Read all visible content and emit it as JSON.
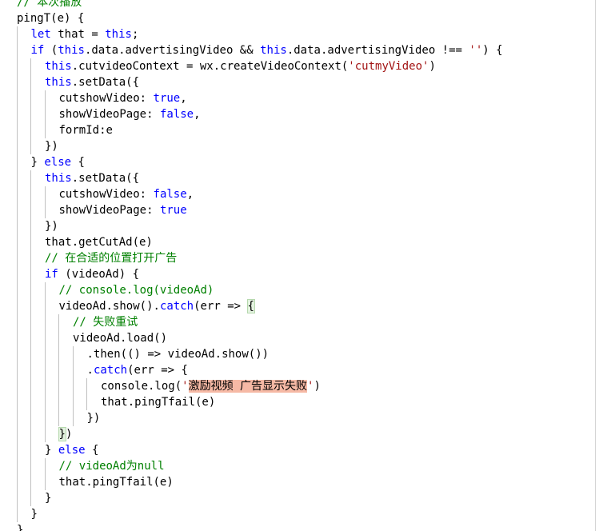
{
  "editor": {
    "colors": {
      "keyword": "#0000ff",
      "string": "#a31515",
      "comment": "#008000",
      "text": "#000000",
      "highlight": "#f6b9a5"
    },
    "lines": [
      {
        "indent": 0,
        "guides": 0,
        "tokens": [
          {
            "c": "cm",
            "v": "// 本次播放"
          }
        ]
      },
      {
        "indent": 0,
        "guides": 0,
        "tokens": [
          {
            "c": "",
            "v": "pingT(e) {"
          }
        ]
      },
      {
        "indent": 1,
        "guides": 1,
        "tokens": [
          {
            "c": "kw",
            "v": "let"
          },
          {
            "c": "",
            "v": " that = "
          },
          {
            "c": "kw",
            "v": "this"
          },
          {
            "c": "",
            "v": ";"
          }
        ]
      },
      {
        "indent": 1,
        "guides": 1,
        "tokens": [
          {
            "c": "kw",
            "v": "if"
          },
          {
            "c": "",
            "v": " ("
          },
          {
            "c": "kw",
            "v": "this"
          },
          {
            "c": "",
            "v": ".data.advertisingVideo && "
          },
          {
            "c": "kw",
            "v": "this"
          },
          {
            "c": "",
            "v": ".data.advertisingVideo !== "
          },
          {
            "c": "str",
            "v": "''"
          },
          {
            "c": "",
            "v": ") {"
          }
        ]
      },
      {
        "indent": 2,
        "guides": 2,
        "tokens": [
          {
            "c": "kw",
            "v": "this"
          },
          {
            "c": "",
            "v": ".cutvideoContext = wx.createVideoContext("
          },
          {
            "c": "str",
            "v": "'cutmyVideo'"
          },
          {
            "c": "",
            "v": ")"
          }
        ]
      },
      {
        "indent": 2,
        "guides": 2,
        "tokens": [
          {
            "c": "kw",
            "v": "this"
          },
          {
            "c": "",
            "v": ".setData({"
          }
        ]
      },
      {
        "indent": 3,
        "guides": 3,
        "tokens": [
          {
            "c": "",
            "v": "cutshowVideo: "
          },
          {
            "c": "kw",
            "v": "true"
          },
          {
            "c": "",
            "v": ","
          }
        ]
      },
      {
        "indent": 3,
        "guides": 3,
        "tokens": [
          {
            "c": "",
            "v": "showVideoPage: "
          },
          {
            "c": "kw",
            "v": "false"
          },
          {
            "c": "",
            "v": ","
          }
        ]
      },
      {
        "indent": 3,
        "guides": 3,
        "tokens": [
          {
            "c": "",
            "v": "formId:e"
          }
        ]
      },
      {
        "indent": 2,
        "guides": 2,
        "tokens": [
          {
            "c": "",
            "v": "})"
          }
        ]
      },
      {
        "indent": 1,
        "guides": 1,
        "tokens": [
          {
            "c": "",
            "v": "} "
          },
          {
            "c": "kw",
            "v": "else"
          },
          {
            "c": "",
            "v": " {"
          }
        ]
      },
      {
        "indent": 2,
        "guides": 2,
        "tokens": [
          {
            "c": "kw",
            "v": "this"
          },
          {
            "c": "",
            "v": ".setData({"
          }
        ]
      },
      {
        "indent": 3,
        "guides": 3,
        "tokens": [
          {
            "c": "",
            "v": "cutshowVideo: "
          },
          {
            "c": "kw",
            "v": "false"
          },
          {
            "c": "",
            "v": ","
          }
        ]
      },
      {
        "indent": 3,
        "guides": 3,
        "tokens": [
          {
            "c": "",
            "v": "showVideoPage: "
          },
          {
            "c": "kw",
            "v": "true"
          }
        ]
      },
      {
        "indent": 2,
        "guides": 2,
        "tokens": [
          {
            "c": "",
            "v": "})"
          }
        ]
      },
      {
        "indent": 2,
        "guides": 2,
        "tokens": [
          {
            "c": "",
            "v": "that.getCutAd(e)"
          }
        ]
      },
      {
        "indent": 2,
        "guides": 2,
        "tokens": [
          {
            "c": "cm",
            "v": "// 在合适的位置打开广告"
          }
        ]
      },
      {
        "indent": 2,
        "guides": 2,
        "tokens": [
          {
            "c": "kw",
            "v": "if"
          },
          {
            "c": "",
            "v": " (videoAd) {"
          }
        ]
      },
      {
        "indent": 3,
        "guides": 3,
        "tokens": [
          {
            "c": "cm",
            "v": "// console.log(videoAd)"
          }
        ]
      },
      {
        "indent": 3,
        "guides": 3,
        "tokens": [
          {
            "c": "",
            "v": "videoAd.show()."
          },
          {
            "c": "kw",
            "v": "catch"
          },
          {
            "c": "",
            "v": "(err => "
          },
          {
            "c": "br",
            "v": "{"
          }
        ]
      },
      {
        "indent": 4,
        "guides": 4,
        "tokens": [
          {
            "c": "cm",
            "v": "// 失败重试"
          }
        ]
      },
      {
        "indent": 4,
        "guides": 4,
        "tokens": [
          {
            "c": "",
            "v": "videoAd.load()"
          }
        ]
      },
      {
        "indent": 5,
        "guides": 5,
        "tokens": [
          {
            "c": "",
            "v": ".then(() => videoAd.show())"
          }
        ]
      },
      {
        "indent": 5,
        "guides": 5,
        "tokens": [
          {
            "c": "",
            "v": "."
          },
          {
            "c": "kw",
            "v": "catch"
          },
          {
            "c": "",
            "v": "(err => {"
          }
        ]
      },
      {
        "indent": 6,
        "guides": 6,
        "tokens": [
          {
            "c": "",
            "v": "console.log("
          },
          {
            "c": "str",
            "v": "'"
          },
          {
            "c": "hl",
            "v": "激励视频 广告显示失败"
          },
          {
            "c": "str",
            "v": "'"
          },
          {
            "c": "",
            "v": ")"
          }
        ]
      },
      {
        "indent": 6,
        "guides": 6,
        "tokens": [
          {
            "c": "",
            "v": "that.pingTfail(e)"
          }
        ]
      },
      {
        "indent": 5,
        "guides": 5,
        "tokens": [
          {
            "c": "",
            "v": "})"
          }
        ]
      },
      {
        "indent": 3,
        "guides": 3,
        "tokens": [
          {
            "c": "br",
            "v": "}"
          },
          {
            "c": "",
            "v": ")"
          }
        ]
      },
      {
        "indent": 2,
        "guides": 2,
        "tokens": [
          {
            "c": "",
            "v": "} "
          },
          {
            "c": "kw",
            "v": "else"
          },
          {
            "c": "",
            "v": " {"
          }
        ]
      },
      {
        "indent": 3,
        "guides": 3,
        "tokens": [
          {
            "c": "cm",
            "v": "// videoAd为null"
          }
        ]
      },
      {
        "indent": 3,
        "guides": 3,
        "tokens": [
          {
            "c": "",
            "v": "that.pingTfail(e)"
          }
        ]
      },
      {
        "indent": 2,
        "guides": 2,
        "tokens": [
          {
            "c": "",
            "v": "}"
          }
        ]
      },
      {
        "indent": 1,
        "guides": 1,
        "tokens": [
          {
            "c": "",
            "v": "}"
          }
        ]
      },
      {
        "indent": 0,
        "guides": 0,
        "tokens": [
          {
            "c": "",
            "v": "},"
          }
        ]
      }
    ]
  }
}
